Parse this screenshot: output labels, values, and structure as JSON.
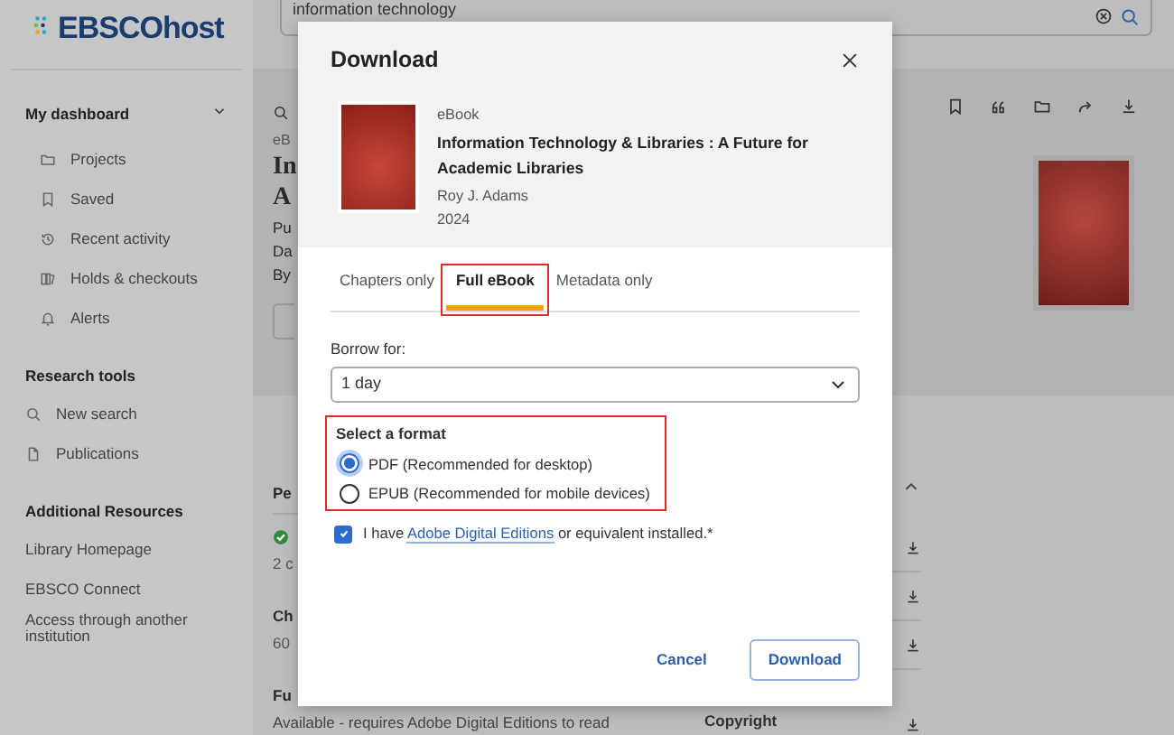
{
  "header": {
    "logo": "EBSCOhost",
    "search_value": "information technology"
  },
  "sidebar": {
    "sections": [
      {
        "title": "My dashboard",
        "expanded": true,
        "items": [
          "Projects",
          "Saved",
          "Recent activity",
          "Holds & checkouts",
          "Alerts"
        ]
      },
      {
        "title": "Research tools",
        "items": [
          "New search",
          "Publications"
        ]
      },
      {
        "title": "Additional Resources",
        "items": [
          "Library Homepage",
          "EBSCO Connect",
          "Access through another institution"
        ]
      }
    ]
  },
  "record": {
    "type": "eB",
    "title_lines": [
      "In",
      "A"
    ],
    "meta": [
      "Pu",
      "Da",
      "By"
    ]
  },
  "details": {
    "heading": "Pe",
    "status": "2 c",
    "label_1": "Ch",
    "value_1": "60",
    "label_2": "Fu",
    "value_2": "Available - requires Adobe Digital Editions to read",
    "side_label": "Copyright"
  },
  "modal": {
    "title": "Download",
    "book": {
      "type": "eBook",
      "title": "Information Technology & Libraries : A Future for Academic Libraries",
      "author": "Roy J. Adams",
      "year": "2024"
    },
    "tabs": [
      {
        "label": "Chapters only",
        "selected": false,
        "highlighted": false
      },
      {
        "label": "Full eBook",
        "selected": true,
        "highlighted": true
      },
      {
        "label": "Metadata only",
        "selected": false,
        "highlighted": false
      }
    ],
    "borrow_label": "Borrow for:",
    "borrow_value": "1 day",
    "format": {
      "label": "Select a format",
      "highlighted": true,
      "options": [
        {
          "label": "PDF (Recommended for desktop)",
          "selected": true
        },
        {
          "label": "EPUB (Recommended for mobile devices)",
          "selected": false
        }
      ]
    },
    "agreement": {
      "checked": true,
      "before": "I have ",
      "link": "Adobe Digital Editions",
      "after": " or equivalent installed.*"
    },
    "buttons": {
      "cancel": "Cancel",
      "confirm": "Download"
    }
  }
}
